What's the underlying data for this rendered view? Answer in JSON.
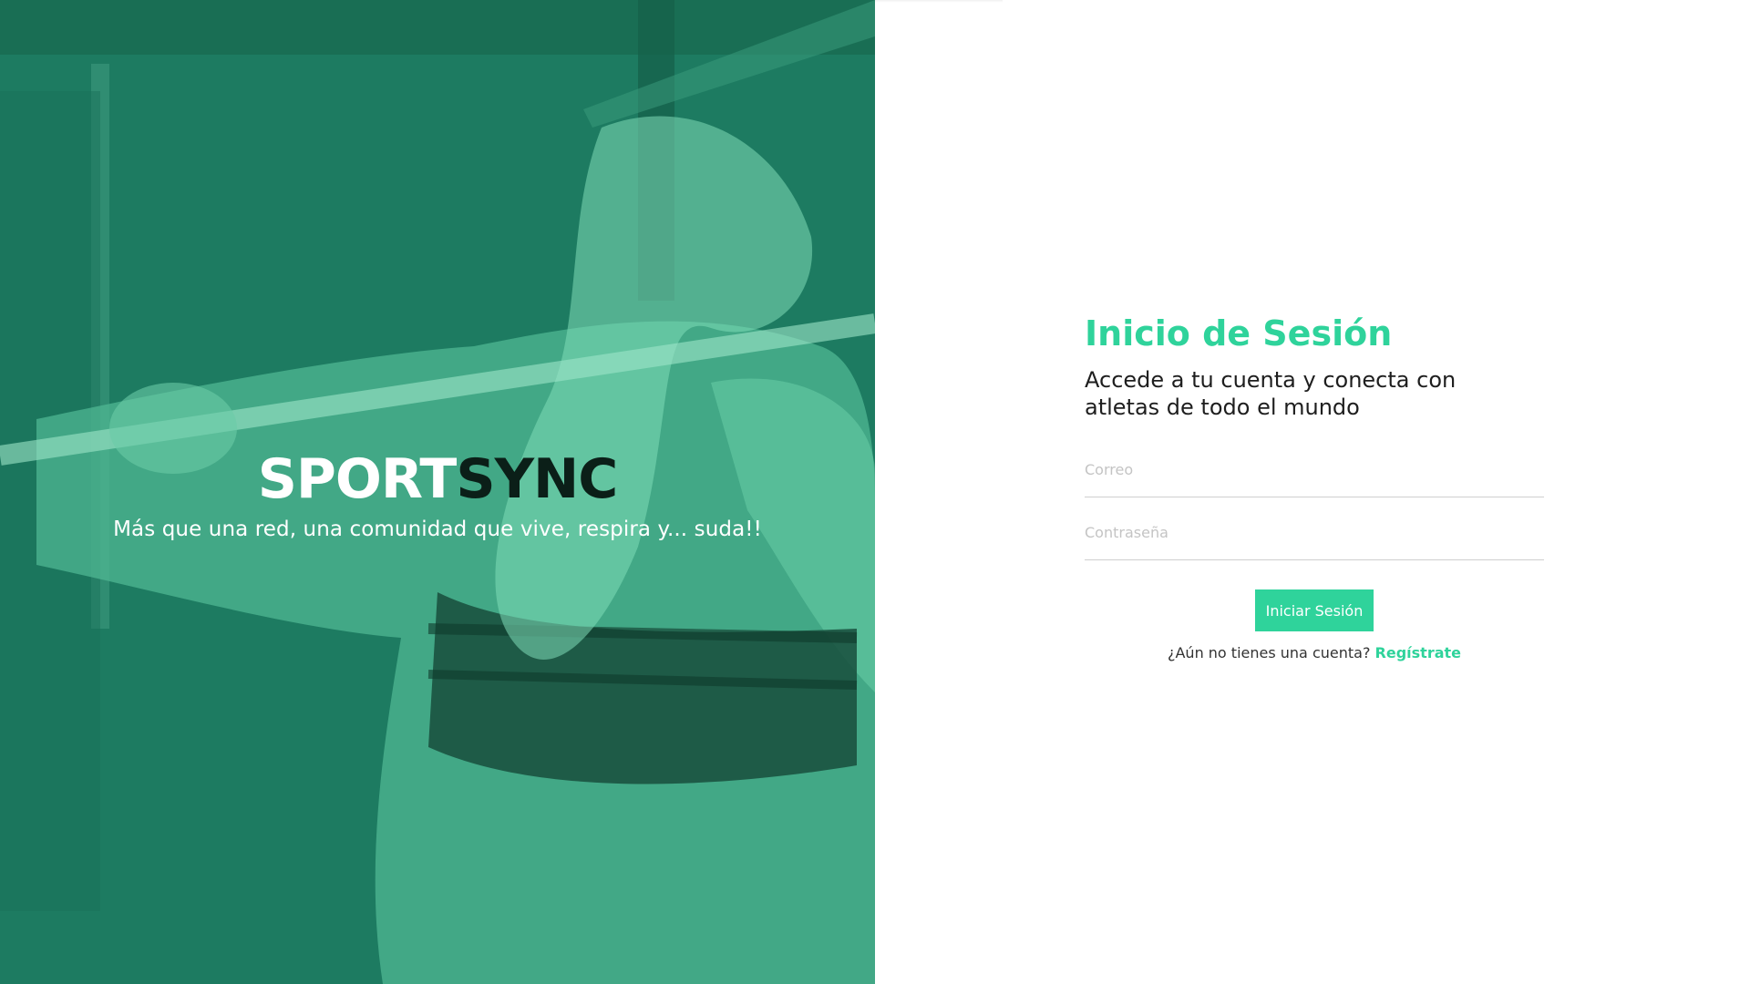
{
  "brand": {
    "part1": "SPORT",
    "part2": "SYNC",
    "tagline": "Más que una red, una comunidad que vive, respira y... suda!!"
  },
  "login": {
    "title": "Inicio de Sesión",
    "subtitle": "Accede a tu cuenta y conecta con atletas de todo el mundo",
    "email_placeholder": "Correo",
    "password_placeholder": "Contraseña",
    "submit_label": "Iniciar Sesión",
    "register_prompt": "¿Aún no tienes una cuenta?",
    "register_link": "Regístrate"
  },
  "colors": {
    "accent": "#2fd39b",
    "hero_overlay": "#1d7b61"
  }
}
